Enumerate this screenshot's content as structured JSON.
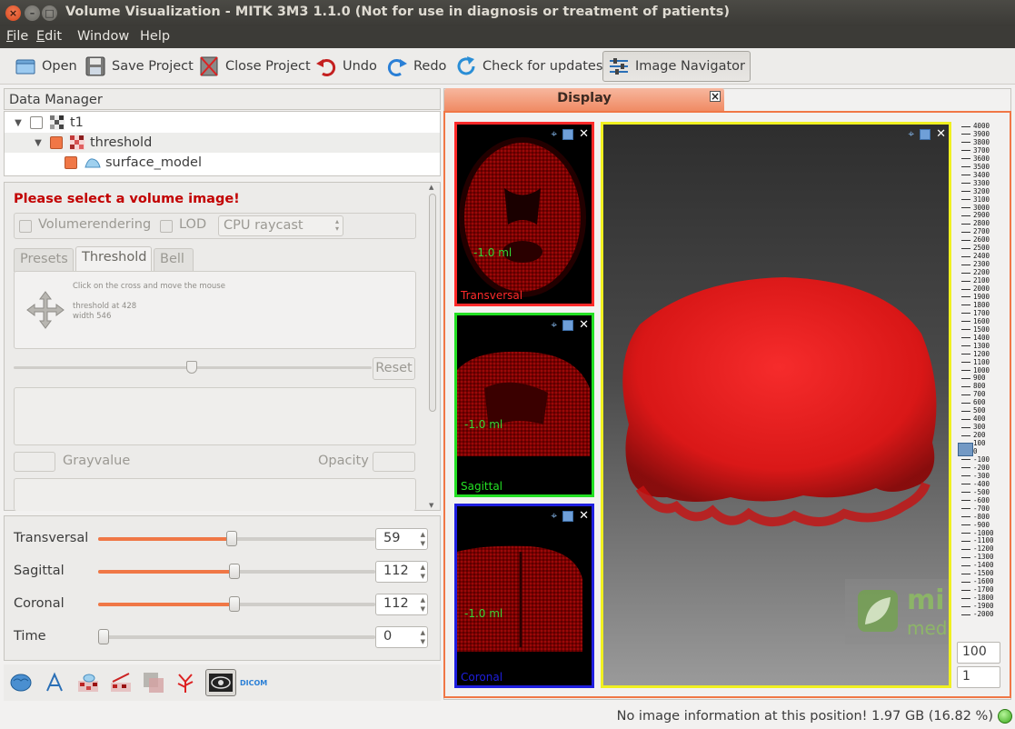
{
  "window": {
    "title": "Volume Visualization - MITK 3M3 1.1.0 (Not for use in diagnosis or treatment of patients)"
  },
  "menu": [
    {
      "label": "File",
      "mnemonic": "F",
      "rest": "ile"
    },
    {
      "label": "Edit",
      "mnemonic": "E",
      "rest": "dit"
    },
    {
      "label": "Window",
      "mnemonic": "",
      "rest": "Window"
    },
    {
      "label": "Help",
      "mnemonic": "",
      "rest": "Help"
    }
  ],
  "toolbar": {
    "open": "Open",
    "save_project": "Save Project",
    "close_project": "Close Project",
    "undo": "Undo",
    "redo": "Redo",
    "check_updates": "Check for updates",
    "image_navigator": "Image Navigator"
  },
  "data_manager": {
    "title": "Data Manager",
    "nodes": [
      {
        "name": "t1",
        "checked": false
      },
      {
        "name": "threshold",
        "checked": true
      },
      {
        "name": "surface_model",
        "checked": true
      }
    ]
  },
  "volume_rendering": {
    "warning": "Please select a volume image!",
    "volumerendering_label": "Volumerendering",
    "lod_label": "LOD",
    "mode_select": "CPU raycast",
    "tabs": [
      "Presets",
      "Threshold",
      "Bell"
    ],
    "active_tab": "Threshold",
    "instructions": "Click on the cross and move the mouse",
    "threshold_text": "threshold at 428",
    "width_text": "width 546",
    "reset_label": "Reset",
    "grayvalue_label": "Grayvalue",
    "opacity_label": "Opacity"
  },
  "slices": {
    "transversal": {
      "label": "Transversal",
      "value": "59",
      "fraction": 0.48
    },
    "sagittal": {
      "label": "Sagittal",
      "value": "112",
      "fraction": 0.49
    },
    "coronal": {
      "label": "Coronal",
      "value": "112",
      "fraction": 0.49
    },
    "time": {
      "label": "Time",
      "value": "0",
      "fraction": 0.0
    }
  },
  "plugins": {
    "dicom_label": "DICOM"
  },
  "display": {
    "tab_label": "Display",
    "views": {
      "transversal": {
        "label": "Transversal",
        "volume": "-1.0 ml",
        "color": "#ff2a2a"
      },
      "sagittal": {
        "label": "Sagittal",
        "volume": "-1.0 ml",
        "color": "#24e024"
      },
      "coronal": {
        "label": "Coronal",
        "volume": "-1.0 ml",
        "color": "#1f1fe0"
      }
    },
    "level_window_ticks": [
      "4000",
      "3900",
      "3800",
      "3700",
      "3600",
      "3500",
      "3400",
      "3300",
      "3200",
      "3100",
      "3000",
      "2900",
      "2800",
      "2700",
      "2600",
      "2500",
      "2400",
      "2300",
      "2200",
      "2100",
      "2000",
      "1900",
      "1800",
      "1700",
      "1600",
      "1500",
      "1400",
      "1300",
      "1200",
      "1100",
      "1000",
      "900",
      "800",
      "700",
      "600",
      "500",
      "400",
      "300",
      "200",
      "100",
      "0",
      "-100",
      "-200",
      "-300",
      "-400",
      "-500",
      "-600",
      "-700",
      "-800",
      "-900",
      "-1000",
      "-1100",
      "-1200",
      "-1300",
      "-1400",
      "-1500",
      "-1600",
      "-1700",
      "-1800",
      "-1900",
      "-2000"
    ],
    "level_value": "100",
    "window_value": "1",
    "logo_text_line1": "mi",
    "logo_text_line2": "med"
  },
  "status": {
    "text": "No image information at this position!  1.97 GB (16.82 %)"
  },
  "colors": {
    "accent": "#f07746",
    "warning": "#c20000",
    "render_red": "#ff1a1a"
  }
}
